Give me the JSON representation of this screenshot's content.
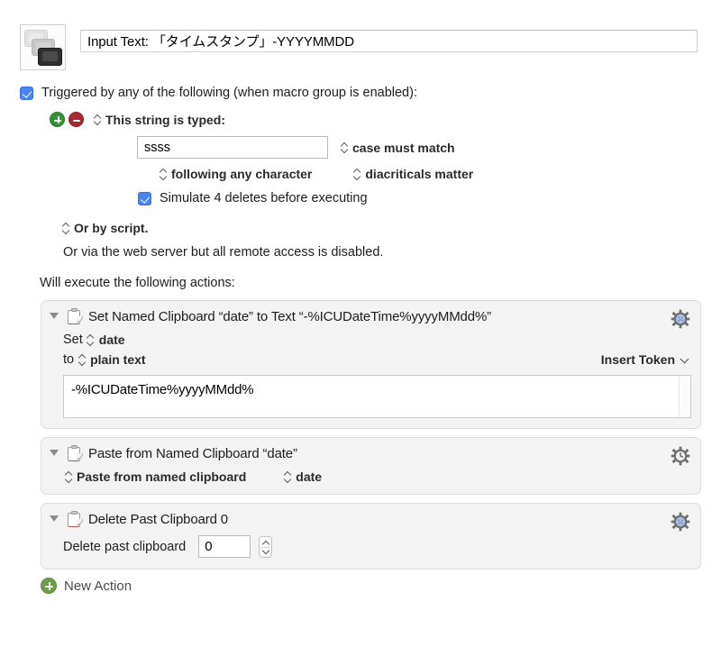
{
  "macro": {
    "icon_name": "macro-stack-icon",
    "title_value": "Input Text: 「タイムスタンプ」-YYYYMMDD"
  },
  "trigger": {
    "enabled_label": "Triggered by any of the following (when macro group is enabled):",
    "add_icon": "plus-circle-icon",
    "remove_icon": "minus-circle-icon",
    "type_label": "This string is typed:",
    "typed_string": "ssss",
    "case_option": "case must match",
    "following_option": "following any character",
    "diacriticals_option": "diacriticals matter",
    "simulate_label": "Simulate 4 deletes before executing",
    "or_by_script": "Or by script.",
    "web_server_note": "Or via the web server but all remote access is disabled."
  },
  "actions_header": "Will execute the following actions:",
  "actions": [
    {
      "title": "Set Named Clipboard “date” to Text “-%ICUDateTime%yyyyMMdd%”",
      "icon": "clipboard-icon",
      "gear_icon": "gear-icon",
      "set_label": "Set",
      "set_value": "date",
      "to_label": "to",
      "to_value": "plain text",
      "insert_token_label": "Insert Token",
      "token_value": "-%ICUDateTime%yyyyMMdd%"
    },
    {
      "title": "Paste from Named Clipboard “date”",
      "icon": "clipboard-icon",
      "gear_icon": "gear-clock-icon",
      "mode_value": "Paste from named clipboard",
      "clipboard_value": "date"
    },
    {
      "title": "Delete Past Clipboard 0",
      "icon": "clipboard-icon",
      "gear_icon": "gear-icon",
      "field_label": "Delete past clipboard",
      "field_value": "0"
    }
  ],
  "new_action": {
    "label": "New Action",
    "icon": "plus-circle-icon"
  },
  "colors": {
    "accent_blue": "#4a84f3",
    "add_green": "#379237",
    "remove_red": "#a52834",
    "panel_bg": "#f3f3f3",
    "gear_gray": "#6e6e6e",
    "gear_center": "#9fb6e0"
  }
}
